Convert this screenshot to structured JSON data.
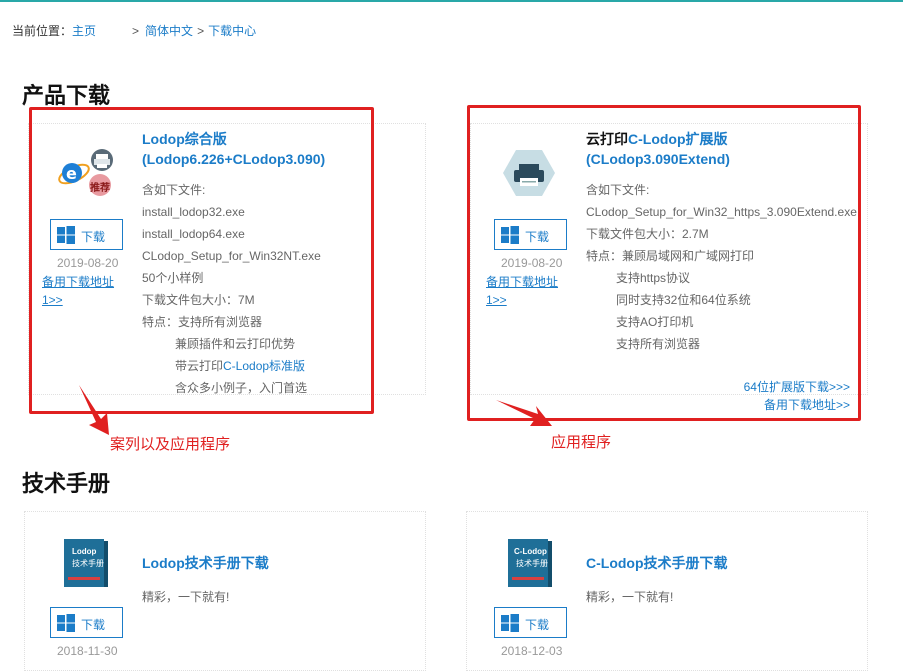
{
  "breadcrumb": {
    "prefix": "当前位置：",
    "home": "主页",
    "sep1": ">",
    "lang": "简体中文",
    "sep2": ">",
    "current": "下载中心"
  },
  "sections": {
    "products": "产品下载",
    "manuals": "技术手册"
  },
  "products": [
    {
      "title_line1": "Lodop综合版",
      "title_line2": "(Lodop6.226+CLodop3.090)",
      "badge": "推荐",
      "download_label": "下载",
      "date": "2019-08-20",
      "alt_link": "备用下载地址1>>",
      "info": {
        "contains": "含如下文件:",
        "file1": "install_lodop32.exe",
        "file2": "install_lodop64.exe",
        "file3": "CLodop_Setup_for_Win32NT.exe",
        "samples": "50个小样例",
        "size": "下载文件包大小：7M",
        "features_label": "特点：支持所有浏览器",
        "f1": "兼顾插件和云打印优势",
        "f2_prefix": "带云打印",
        "f2_link": "C-Lodop标准版",
        "f3": "含众多小例子，入门首选"
      }
    },
    {
      "title_dark": "云打印",
      "title_line1_rest": "C-Lodop扩展版",
      "title_line2": "(CLodop3.090Extend)",
      "download_label": "下载",
      "date": "2019-08-20",
      "alt_link": "备用下载地址1>>",
      "info": {
        "contains": "含如下文件:",
        "file1": "CLodop_Setup_for_Win32_https_3.090Extend.exe",
        "size": "下载文件包大小：2.7M",
        "features_label": "特点：兼顾局域网和广域网打印",
        "f1": "支持https协议",
        "f2": "同时支持32位和64位系统",
        "f3": "支持AO打印机",
        "f4": "支持所有浏览器"
      },
      "link64": "64位扩展版下载>>>",
      "alt_link2": "备用下载地址>>"
    }
  ],
  "annotations": {
    "left": "案列以及应用程序",
    "right": "应用程序"
  },
  "manuals": [
    {
      "title": "Lodop技术手册下载",
      "book_text1": "Lodop",
      "book_text2": "技术手册",
      "desc": "精彩，一下就有!",
      "download_label": "下载",
      "date": "2018-11-30"
    },
    {
      "title": "C-Lodop技术手册下载",
      "book_text1": "C-Lodop",
      "book_text2": "技术手册",
      "desc": "精彩，一下就有!",
      "download_label": "下载",
      "date": "2018-12-03"
    }
  ],
  "colors": {
    "accent": "#1b7cc8",
    "annotation": "#e02020",
    "top_bar": "#29a8a8"
  }
}
